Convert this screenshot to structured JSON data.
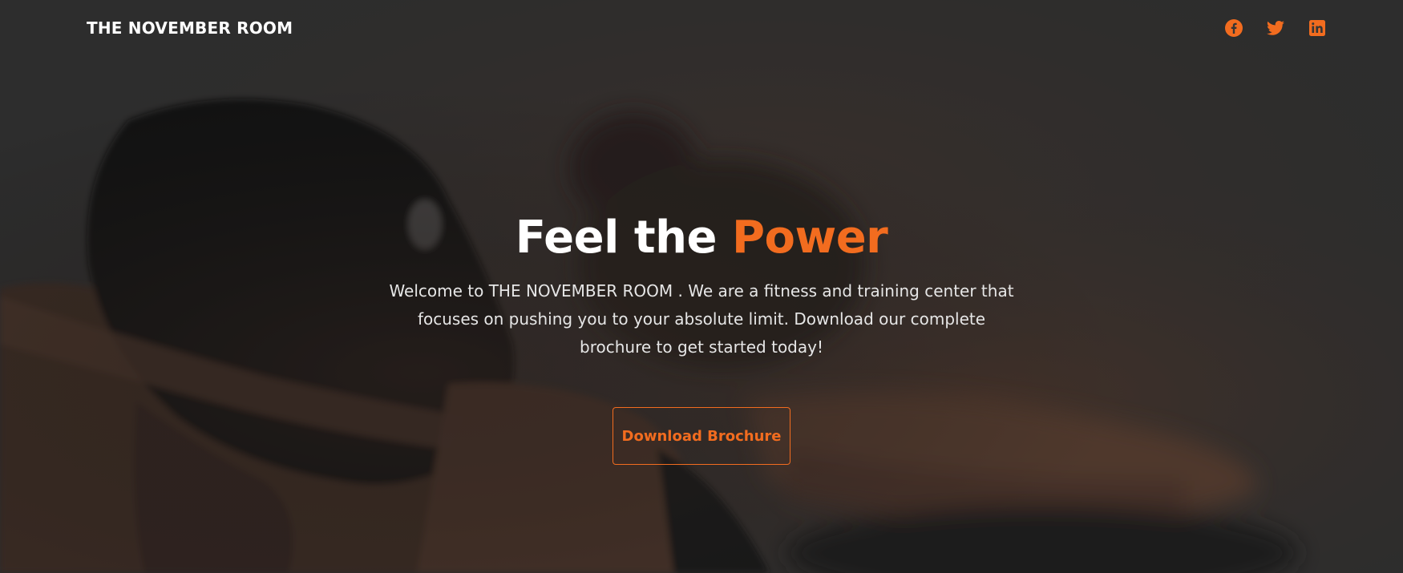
{
  "header": {
    "brand": "THE NOVEMBER ROOM",
    "social": [
      {
        "name": "facebook-icon"
      },
      {
        "name": "twitter-icon"
      },
      {
        "name": "linkedin-icon"
      }
    ]
  },
  "hero": {
    "headline_prefix": "Feel the",
    "headline_accent": "Power",
    "description": "Welcome to THE NOVEMBER ROOM . We are a fitness and training center that focuses on pushing you to your absolute limit. Download our complete brochure to get started today!",
    "cta_label": "Download Brochure"
  },
  "theme": {
    "accent": "#f26c1f",
    "text": "#ffffff",
    "background": "#353535"
  }
}
